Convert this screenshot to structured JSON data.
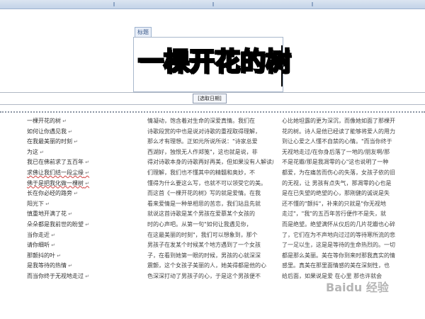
{
  "title_tag": "标题",
  "title": "一棵开花的树",
  "date_control": "[选取日期]",
  "col1": [
    "一棵开花的树",
    "如何让你遇见我",
    "在我最美丽的时刻",
    "为这",
    "我已在佛前求了五百年",
    "求佛让我们结一段尘缘",
    "佛于是把我化做一棵树",
    "长在你必经的路旁",
    "阳光下",
    "慎重地开满了花",
    "朵朵都是我前世的盼望",
    "当你走近",
    "请你细听",
    "那颤抖的叶",
    "是我等待的热情",
    "而当你终于无视地走过"
  ],
  "col2": [
    "情凝动，饱含着对生命的深爱真情。我们在",
    "诗歌段赏的中也是说对诗歌的重视取得理解，",
    "那么才有理想。正如元所说所说：\"诗家总爱",
    "西湖好，独恨无人作郑笺\"，这也就是说，非",
    "得对诗歌本身的诗歌再好再美，但如果没有人解读启",
    "们理解，我们也不懂其中的精髓和奥妙，不",
    "懂得为什么要这么写，也就不可以领受它的美。",
    "而这首《一棵开花的树》写的就是爱情。在我",
    "看来爱情是一种单相思的苦恋，我们站且先就",
    "就说这首诗歌是某个男孩在爱慕某个女孩的",
    "时的心声吧。从第一句\"如何让我遇见你，",
    "在这最美丽的时刻\"，我们可以想象到，那个",
    "男孩子在发某个时候某个地方遇到了一个女孩",
    "子，在看到她第一眼的时候，男孩的心就深深",
    "震颤，这个女孩子美丽的人，她美得都是他的心",
    "色深深打动了男孩子的心，于是这个男孩便不"
  ],
  "col3": [
    "心比她坦露的更为深沉，而像她如面了那棵开",
    "花的树。诗人是他已经读了能够将爱人的用力",
    "到让心爱之人懂不自禁的心情。\"而当你终于",
    "无视地走过/在你身后落了一地的/朋友啊/那",
    "不是花瓣/那是我凋零的心\"这也说明了一种",
    "都爱，为在痛苦而伤心的失落，女孩子依的旧",
    "的无视，让 男孩有点失气，那凋零的心也是",
    "是在已失望的绝望的心，那刚健的诚说是失",
    "还不懂的\"颤抖\"，补来的只就是\"你无视地",
    "走过\"，\"我\"的五百年苦行便作不是失，就",
    "而是绝望。绝望满怀从仪后的几片花瓣也心碎",
    "了，它们在为不声地向过过的等待寒所流的悲",
    "了一足以生，这是是等待的生命热烈的。一切",
    "都是那么美丽。美在等你到来时那我真实的情",
    "感里。真美在那里面情感的美在深刻性，也",
    "给后面，如果说是爱 在心里 那也许就会"
  ],
  "watermark": "Baidu 经验"
}
